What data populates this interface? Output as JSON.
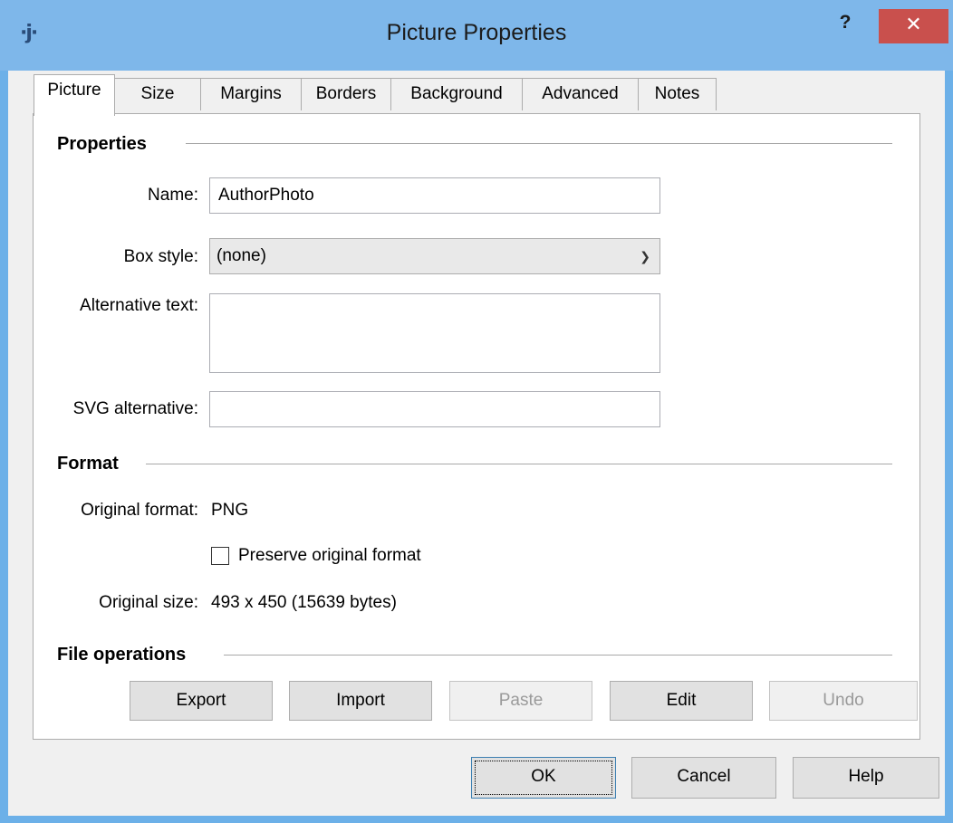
{
  "window": {
    "title": "Picture Properties",
    "app_icon": "·j·",
    "help_glyph": "?",
    "close_glyph": "✕"
  },
  "tabs": [
    {
      "label": "Picture",
      "active": true
    },
    {
      "label": "Size"
    },
    {
      "label": "Margins"
    },
    {
      "label": "Borders"
    },
    {
      "label": "Background"
    },
    {
      "label": "Advanced"
    },
    {
      "label": "Notes"
    }
  ],
  "properties": {
    "section_title": "Properties",
    "name_label": "Name:",
    "name_value": "AuthorPhoto",
    "box_style_label": "Box style:",
    "box_style_value": "(none)",
    "alt_text_label": "Alternative text:",
    "alt_text_value": "",
    "svg_alt_label": "SVG alternative:",
    "svg_alt_value": ""
  },
  "format": {
    "section_title": "Format",
    "original_format_label": "Original format:",
    "original_format_value": "PNG",
    "preserve_label": "Preserve original format",
    "preserve_checked": false,
    "original_size_label": "Original size:",
    "original_size_value": "493 x 450 (15639 bytes)"
  },
  "file_operations": {
    "section_title": "File operations",
    "export_label": "Export",
    "import_label": "Import",
    "paste_label": "Paste",
    "edit_label": "Edit",
    "undo_label": "Undo"
  },
  "footer": {
    "ok_label": "OK",
    "cancel_label": "Cancel",
    "help_label": "Help"
  }
}
